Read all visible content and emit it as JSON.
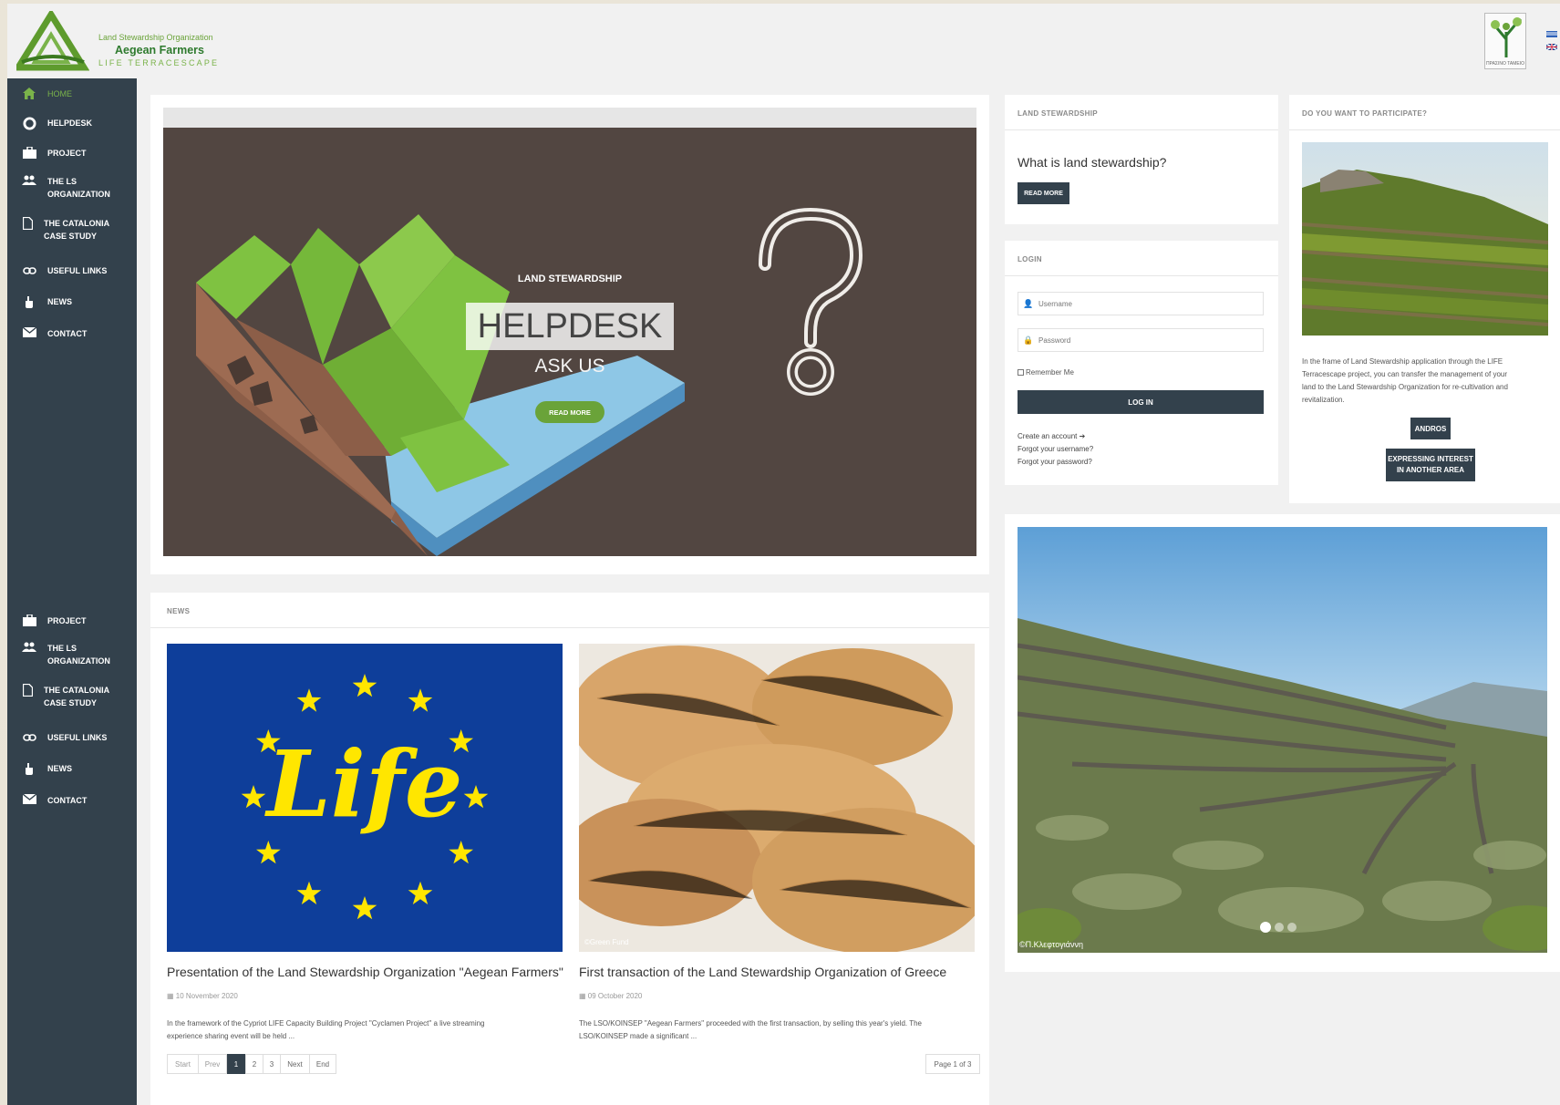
{
  "header": {
    "logo": {
      "line1": "Land Stewardship Organization",
      "line2": "Aegean Farmers",
      "line3": "LIFE TERRACESCAPE"
    },
    "partner_caption": "ΠΡΑΣΙΝΟ ΤΑΜΕΙΟ",
    "languages": [
      "el",
      "en"
    ]
  },
  "sidebar": {
    "top": [
      {
        "label": "HOME",
        "icon": "home-icon"
      },
      {
        "label": "HELPDESK",
        "icon": "lifebuoy-icon"
      },
      {
        "label": "PROJECT",
        "icon": "briefcase-icon"
      },
      {
        "label": "THE LS ORGANIZATION",
        "line1": "THE LS",
        "line2": "ORGANIZATION",
        "icon": "users-icon"
      },
      {
        "label": "THE CATALONIA CASE STUDY",
        "line1": "THE CATALONIA",
        "line2": "CASE STUDY",
        "icon": "file-icon"
      },
      {
        "label": "USEFUL LINKS",
        "icon": "link-icon"
      },
      {
        "label": "NEWS",
        "icon": "hand-icon"
      },
      {
        "label": "CONTACT",
        "icon": "envelope-icon"
      }
    ],
    "bottom": [
      {
        "label": "PROJECT",
        "icon": "briefcase-icon"
      },
      {
        "label": "THE LS ORGANIZATION",
        "line1": "THE LS",
        "line2": "ORGANIZATION",
        "icon": "users-icon"
      },
      {
        "label": "THE CATALONIA CASE STUDY",
        "line1": "THE CATALONIA",
        "line2": "CASE STUDY",
        "icon": "file-icon"
      },
      {
        "label": "USEFUL LINKS",
        "icon": "link-icon"
      },
      {
        "label": "NEWS",
        "icon": "hand-icon"
      },
      {
        "label": "CONTACT",
        "icon": "envelope-icon"
      }
    ]
  },
  "hero": {
    "kicker": "LAND STEWARDSHIP",
    "title": "HELPDESK",
    "subtitle": "ASK US",
    "button": "READ MORE"
  },
  "news": {
    "title": "NEWS",
    "items": [
      {
        "title": "Presentation of the Land Stewardship Organization \"Aegean Farmers\"",
        "date": "10 November 2020",
        "excerpt_line1": "In the framework of the Cypriot LIFE Capacity Building Project \"Cyclamen Project\" a live streaming",
        "excerpt_line2": "experience sharing event will be held ...",
        "image_text": "Life"
      },
      {
        "title": "First transaction of the Land Stewardship Organization of Greece",
        "date": "09 October 2020",
        "excerpt_line1": "The LSO/KOINSEP \"Aegean Farmers\" proceeded with the first transaction, by selling this year's yield. The",
        "excerpt_line2": "LSO/KOINSEP made a significant ...",
        "image_credit": "©Green Fund"
      }
    ],
    "pagination": {
      "start": "Start",
      "prev": "Prev",
      "pages": [
        "1",
        "2",
        "3"
      ],
      "next": "Next",
      "end": "End",
      "summary": "Page 1 of 3"
    }
  },
  "stewardship": {
    "title": "LAND STEWARDSHIP",
    "question": "What is land stewardship?",
    "button": "READ MORE"
  },
  "login": {
    "title": "LOGIN",
    "username_placeholder": "Username",
    "password_placeholder": "Password",
    "remember": "Remember Me",
    "button": "LOG IN",
    "create": "Create an account",
    "forgot_user": "Forgot your username?",
    "forgot_pass": "Forgot your password?"
  },
  "participate": {
    "title": "DO YOU WANT TO PARTICIPATE?",
    "text_line1": "In the frame of Land Stewardship application through the LIFE",
    "text_line2": "Terracescape project, you can transfer the management of your",
    "text_line3": "land to the Land Stewardship Organization for re-cultivation and",
    "text_line4": "revitalization.",
    "button1": "ANDROS",
    "button2_line1": "EXPRESSING INTEREST",
    "button2_line2": "IN ANOTHER AREA"
  },
  "slideshow": {
    "credit": "©Π.Κλεφτογιάννη"
  },
  "colors": {
    "accent": "#7ab34a",
    "sidebar": "#33414c",
    "eu_blue": "#0e3e9a",
    "eu_yellow": "#ffe600",
    "hero_bg": "#524641"
  }
}
